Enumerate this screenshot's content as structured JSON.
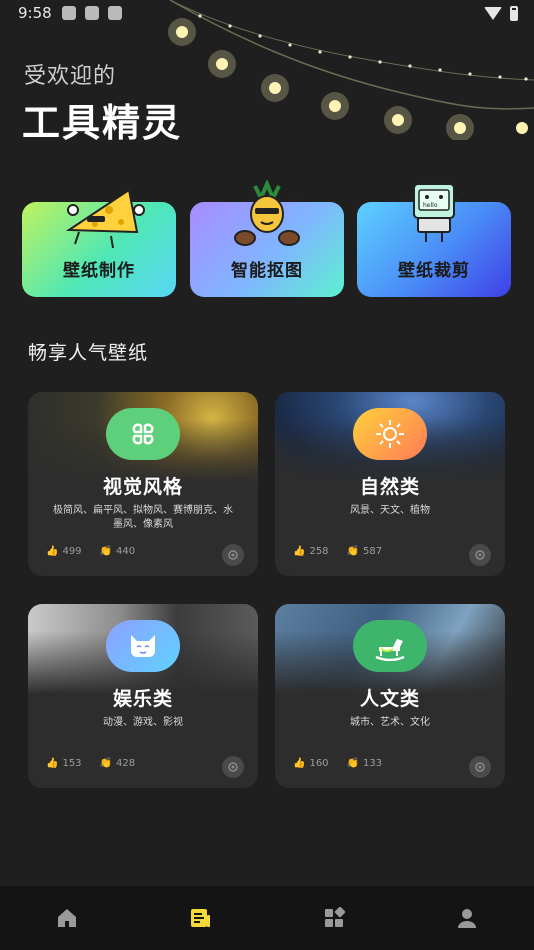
{
  "status_bar": {
    "time": "9:58"
  },
  "header": {
    "subtitle": "受欢迎的",
    "title": "工具精灵"
  },
  "tools": [
    {
      "label": "壁纸制作",
      "icon": "cheese-mascot-icon"
    },
    {
      "label": "智能抠图",
      "icon": "pineapple-drummer-icon"
    },
    {
      "label": "壁纸裁剪",
      "icon": "computer-hello-icon"
    }
  ],
  "section": {
    "title": "畅享人气壁纸"
  },
  "categories": [
    {
      "name": "视觉风格",
      "desc": "极简风、扁平风、拟物风、赛博朋克、水墨风、像素风",
      "likes": "499",
      "claps": "440",
      "icon": "four-petal-icon"
    },
    {
      "name": "自然类",
      "desc": "风景、天文、植物",
      "likes": "258",
      "claps": "587",
      "icon": "sun-icon"
    },
    {
      "name": "娱乐类",
      "desc": "动漫、游戏、影视",
      "likes": "153",
      "claps": "428",
      "icon": "cat-face-icon"
    },
    {
      "name": "人文类",
      "desc": "城市、艺术、文化",
      "likes": "160",
      "claps": "133",
      "icon": "rocking-horse-icon"
    }
  ],
  "tabbar": [
    {
      "icon": "home-icon",
      "active": false
    },
    {
      "icon": "notes-icon",
      "active": true
    },
    {
      "icon": "grid-icon",
      "active": false
    },
    {
      "icon": "user-icon",
      "active": false
    }
  ],
  "colors": {
    "background": "#1f1f1f",
    "card": "#2d2d2d",
    "tab_active": "#f5d938",
    "tab_inactive": "#9a9a9a"
  }
}
